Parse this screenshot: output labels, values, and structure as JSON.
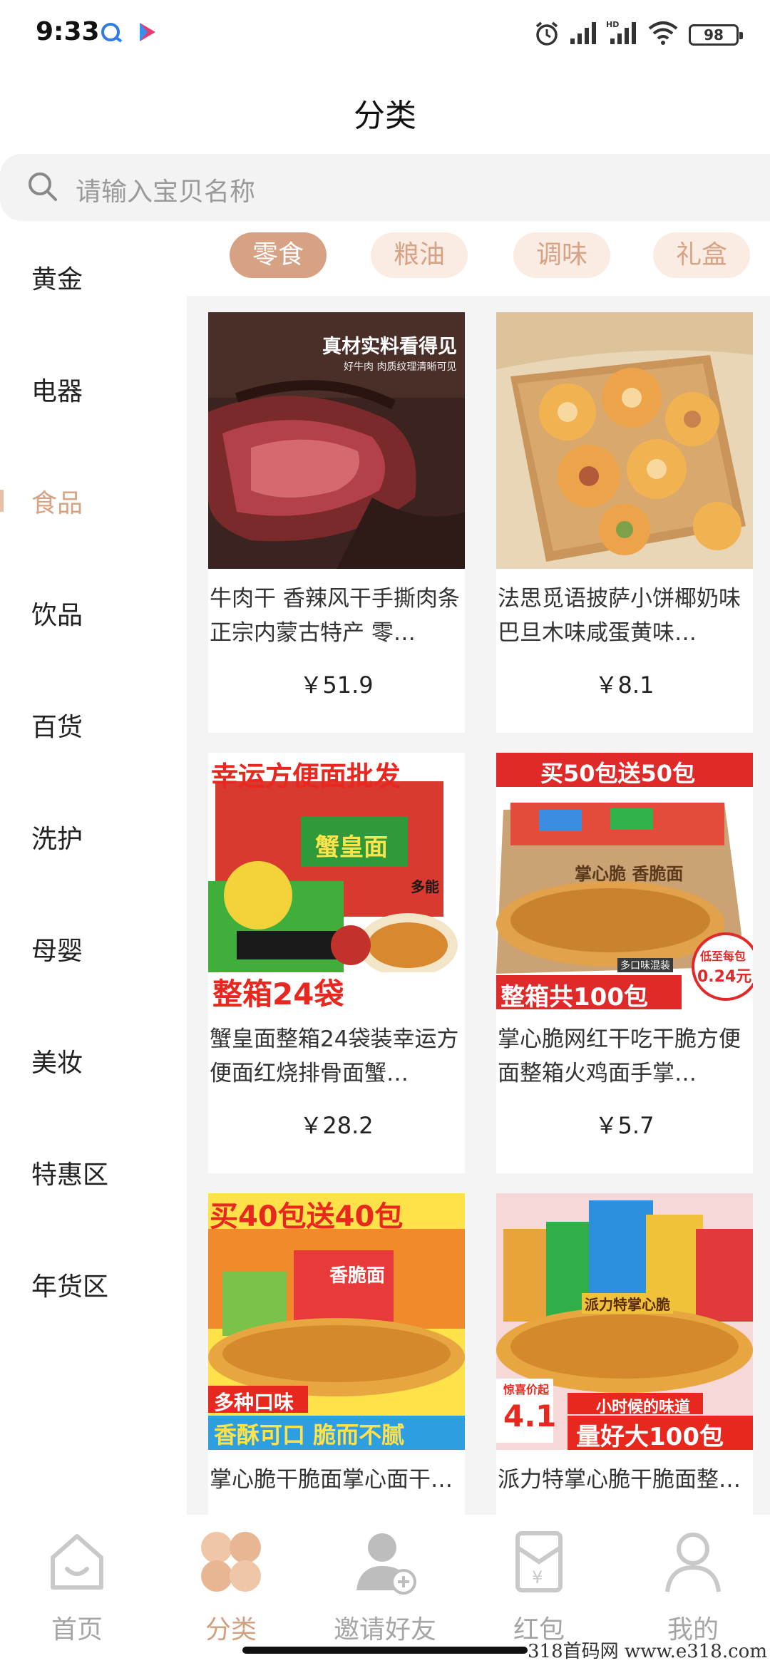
{
  "status_bar": {
    "time": "9:33",
    "battery": "98"
  },
  "page": {
    "title": "分类"
  },
  "search": {
    "placeholder": "请输入宝贝名称"
  },
  "sidebar": {
    "items": [
      {
        "label": "黄金"
      },
      {
        "label": "电器"
      },
      {
        "label": "食品"
      },
      {
        "label": "饮品"
      },
      {
        "label": "百货"
      },
      {
        "label": "洗护"
      },
      {
        "label": "母婴"
      },
      {
        "label": "美妆"
      },
      {
        "label": "特惠区"
      },
      {
        "label": "年货区"
      }
    ],
    "active_label": "食品"
  },
  "subtabs": {
    "items": [
      {
        "label": "零食"
      },
      {
        "label": "粮油"
      },
      {
        "label": "调味"
      },
      {
        "label": "礼盒"
      }
    ],
    "active_label": "零食"
  },
  "products": [
    {
      "title": "牛肉干 香辣风干手撕肉条正宗内蒙古特产 零…",
      "price": "￥51.9",
      "image_text": [
        "真材实料看得见",
        "好牛肉 肉质纹理清晰可见"
      ]
    },
    {
      "title": "法思觅语披萨小饼椰奶味巴旦木味咸蛋黄味…",
      "price": "￥8.1",
      "image_text": []
    },
    {
      "title": "蟹皇面整箱24袋装幸运方便面红烧排骨面蟹…",
      "price": "￥28.2",
      "image_text": [
        "幸运方便面批发",
        "蟹皇面",
        "整箱24袋",
        "多能"
      ]
    },
    {
      "title": "掌心脆网红干吃干脆方便面整箱火鸡面手掌…",
      "price": "￥5.7",
      "image_text": [
        "买50包送50包",
        "掌心脆 香脆面",
        "整箱共100包",
        "低至每包",
        "0.24元",
        "多口味混装"
      ]
    },
    {
      "title": "掌心脆干脆面掌心面干…",
      "price": "",
      "image_text": [
        "买40包送40包",
        "香脆面",
        "多种口味",
        "香酥可口 脆而不腻"
      ]
    },
    {
      "title": "派力特掌心脆干脆面整…",
      "price": "",
      "image_text": [
        "派力特掌心脆",
        "惊喜价",
        "4.1",
        "起",
        "小时候的味道",
        "量好大100包"
      ]
    }
  ],
  "bottom_nav": {
    "items": [
      {
        "label": "首页"
      },
      {
        "label": "分类"
      },
      {
        "label": "邀请好友"
      },
      {
        "label": "红包"
      },
      {
        "label": "我的"
      }
    ],
    "active_label": "分类"
  },
  "watermark": "318首码网 www.e318.com",
  "colors": {
    "accent": "#d6a283",
    "accent_light": "#fbece3",
    "inactive": "#a5a5a5"
  }
}
